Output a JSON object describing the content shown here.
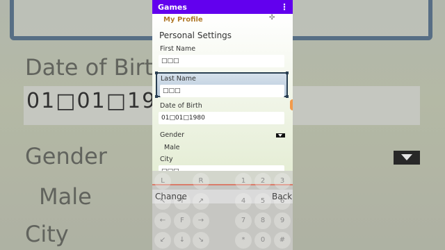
{
  "app_bar": {
    "title": "Games",
    "menu_icon": "more-vert-icon"
  },
  "profile": {
    "tab_label": "My Profile",
    "section_title": "Personal Settings",
    "first_name": {
      "label": "First Name",
      "value": "□□□"
    },
    "last_name": {
      "label": "Last Name",
      "value": "□□□"
    },
    "dob": {
      "label": "Date of Birth",
      "value": "01□01□1980"
    },
    "gender": {
      "label": "Gender",
      "value": "Male"
    },
    "city": {
      "label": "City",
      "value": "□□□"
    }
  },
  "softkeys": {
    "left": "Change",
    "right": "Back"
  },
  "keypad": {
    "row1": [
      "L",
      "R",
      "1",
      "2",
      "3"
    ],
    "row2": [
      "↖",
      "↑",
      "↗",
      "4",
      "5",
      "6"
    ],
    "row3": [
      "←",
      "F",
      "→",
      "7",
      "8",
      "9"
    ],
    "row4": [
      "↙",
      "↓",
      "↘",
      "*",
      "0",
      "#"
    ]
  },
  "background_zoom": {
    "box_text": "□□□",
    "dob_label": "Date of Birth",
    "dob_value": "01□01□1980",
    "gender_label": "Gender",
    "gender_value": "Male",
    "city_label": "City"
  },
  "colors": {
    "app_bar": "#6200ee",
    "selection_border": "#2a3f52",
    "profile_tab": "#b07a2a"
  }
}
